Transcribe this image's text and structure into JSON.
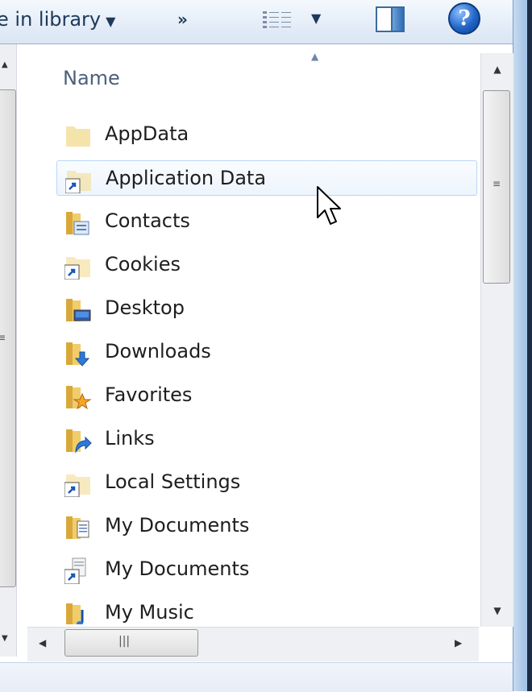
{
  "toolbar": {
    "include_in_library": "e in library",
    "more_chevron": "»"
  },
  "file_list": {
    "column_header": "Name",
    "items": [
      {
        "name": "AppData",
        "icon": "folder-hidden-icon"
      },
      {
        "name": "Application Data",
        "icon": "shortcut-icon"
      },
      {
        "name": "Contacts",
        "icon": "contacts-folder-icon"
      },
      {
        "name": "Cookies",
        "icon": "shortcut-icon"
      },
      {
        "name": "Desktop",
        "icon": "desktop-folder-icon"
      },
      {
        "name": "Downloads",
        "icon": "downloads-folder-icon"
      },
      {
        "name": "Favorites",
        "icon": "favorites-folder-icon"
      },
      {
        "name": "Links",
        "icon": "links-folder-icon"
      },
      {
        "name": "Local Settings",
        "icon": "shortcut-icon"
      },
      {
        "name": "My Documents",
        "icon": "documents-folder-icon"
      },
      {
        "name": "My Documents",
        "icon": "shortcut-icon"
      },
      {
        "name": "My Music",
        "icon": "music-folder-icon"
      }
    ],
    "hovered_index": 1
  },
  "colors": {
    "accent": "#1e395b",
    "hover_border": "#b8d6fb",
    "folder": "#e9c15a"
  }
}
